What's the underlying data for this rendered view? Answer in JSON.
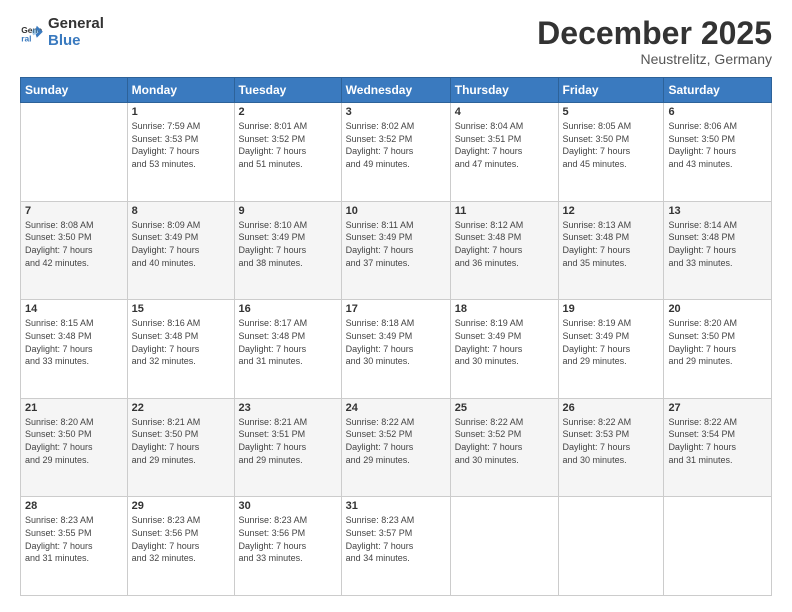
{
  "logo": {
    "line1": "General",
    "line2": "Blue"
  },
  "header": {
    "month": "December 2025",
    "location": "Neustrelitz, Germany"
  },
  "weekdays": [
    "Sunday",
    "Monday",
    "Tuesday",
    "Wednesday",
    "Thursday",
    "Friday",
    "Saturday"
  ],
  "weeks": [
    [
      {
        "day": "",
        "info": ""
      },
      {
        "day": "1",
        "info": "Sunrise: 7:59 AM\nSunset: 3:53 PM\nDaylight: 7 hours\nand 53 minutes."
      },
      {
        "day": "2",
        "info": "Sunrise: 8:01 AM\nSunset: 3:52 PM\nDaylight: 7 hours\nand 51 minutes."
      },
      {
        "day": "3",
        "info": "Sunrise: 8:02 AM\nSunset: 3:52 PM\nDaylight: 7 hours\nand 49 minutes."
      },
      {
        "day": "4",
        "info": "Sunrise: 8:04 AM\nSunset: 3:51 PM\nDaylight: 7 hours\nand 47 minutes."
      },
      {
        "day": "5",
        "info": "Sunrise: 8:05 AM\nSunset: 3:50 PM\nDaylight: 7 hours\nand 45 minutes."
      },
      {
        "day": "6",
        "info": "Sunrise: 8:06 AM\nSunset: 3:50 PM\nDaylight: 7 hours\nand 43 minutes."
      }
    ],
    [
      {
        "day": "7",
        "info": "Sunrise: 8:08 AM\nSunset: 3:50 PM\nDaylight: 7 hours\nand 42 minutes."
      },
      {
        "day": "8",
        "info": "Sunrise: 8:09 AM\nSunset: 3:49 PM\nDaylight: 7 hours\nand 40 minutes."
      },
      {
        "day": "9",
        "info": "Sunrise: 8:10 AM\nSunset: 3:49 PM\nDaylight: 7 hours\nand 38 minutes."
      },
      {
        "day": "10",
        "info": "Sunrise: 8:11 AM\nSunset: 3:49 PM\nDaylight: 7 hours\nand 37 minutes."
      },
      {
        "day": "11",
        "info": "Sunrise: 8:12 AM\nSunset: 3:48 PM\nDaylight: 7 hours\nand 36 minutes."
      },
      {
        "day": "12",
        "info": "Sunrise: 8:13 AM\nSunset: 3:48 PM\nDaylight: 7 hours\nand 35 minutes."
      },
      {
        "day": "13",
        "info": "Sunrise: 8:14 AM\nSunset: 3:48 PM\nDaylight: 7 hours\nand 33 minutes."
      }
    ],
    [
      {
        "day": "14",
        "info": "Sunrise: 8:15 AM\nSunset: 3:48 PM\nDaylight: 7 hours\nand 33 minutes."
      },
      {
        "day": "15",
        "info": "Sunrise: 8:16 AM\nSunset: 3:48 PM\nDaylight: 7 hours\nand 32 minutes."
      },
      {
        "day": "16",
        "info": "Sunrise: 8:17 AM\nSunset: 3:48 PM\nDaylight: 7 hours\nand 31 minutes."
      },
      {
        "day": "17",
        "info": "Sunrise: 8:18 AM\nSunset: 3:49 PM\nDaylight: 7 hours\nand 30 minutes."
      },
      {
        "day": "18",
        "info": "Sunrise: 8:19 AM\nSunset: 3:49 PM\nDaylight: 7 hours\nand 30 minutes."
      },
      {
        "day": "19",
        "info": "Sunrise: 8:19 AM\nSunset: 3:49 PM\nDaylight: 7 hours\nand 29 minutes."
      },
      {
        "day": "20",
        "info": "Sunrise: 8:20 AM\nSunset: 3:50 PM\nDaylight: 7 hours\nand 29 minutes."
      }
    ],
    [
      {
        "day": "21",
        "info": "Sunrise: 8:20 AM\nSunset: 3:50 PM\nDaylight: 7 hours\nand 29 minutes."
      },
      {
        "day": "22",
        "info": "Sunrise: 8:21 AM\nSunset: 3:50 PM\nDaylight: 7 hours\nand 29 minutes."
      },
      {
        "day": "23",
        "info": "Sunrise: 8:21 AM\nSunset: 3:51 PM\nDaylight: 7 hours\nand 29 minutes."
      },
      {
        "day": "24",
        "info": "Sunrise: 8:22 AM\nSunset: 3:52 PM\nDaylight: 7 hours\nand 29 minutes."
      },
      {
        "day": "25",
        "info": "Sunrise: 8:22 AM\nSunset: 3:52 PM\nDaylight: 7 hours\nand 30 minutes."
      },
      {
        "day": "26",
        "info": "Sunrise: 8:22 AM\nSunset: 3:53 PM\nDaylight: 7 hours\nand 30 minutes."
      },
      {
        "day": "27",
        "info": "Sunrise: 8:22 AM\nSunset: 3:54 PM\nDaylight: 7 hours\nand 31 minutes."
      }
    ],
    [
      {
        "day": "28",
        "info": "Sunrise: 8:23 AM\nSunset: 3:55 PM\nDaylight: 7 hours\nand 31 minutes."
      },
      {
        "day": "29",
        "info": "Sunrise: 8:23 AM\nSunset: 3:56 PM\nDaylight: 7 hours\nand 32 minutes."
      },
      {
        "day": "30",
        "info": "Sunrise: 8:23 AM\nSunset: 3:56 PM\nDaylight: 7 hours\nand 33 minutes."
      },
      {
        "day": "31",
        "info": "Sunrise: 8:23 AM\nSunset: 3:57 PM\nDaylight: 7 hours\nand 34 minutes."
      },
      {
        "day": "",
        "info": ""
      },
      {
        "day": "",
        "info": ""
      },
      {
        "day": "",
        "info": ""
      }
    ]
  ]
}
